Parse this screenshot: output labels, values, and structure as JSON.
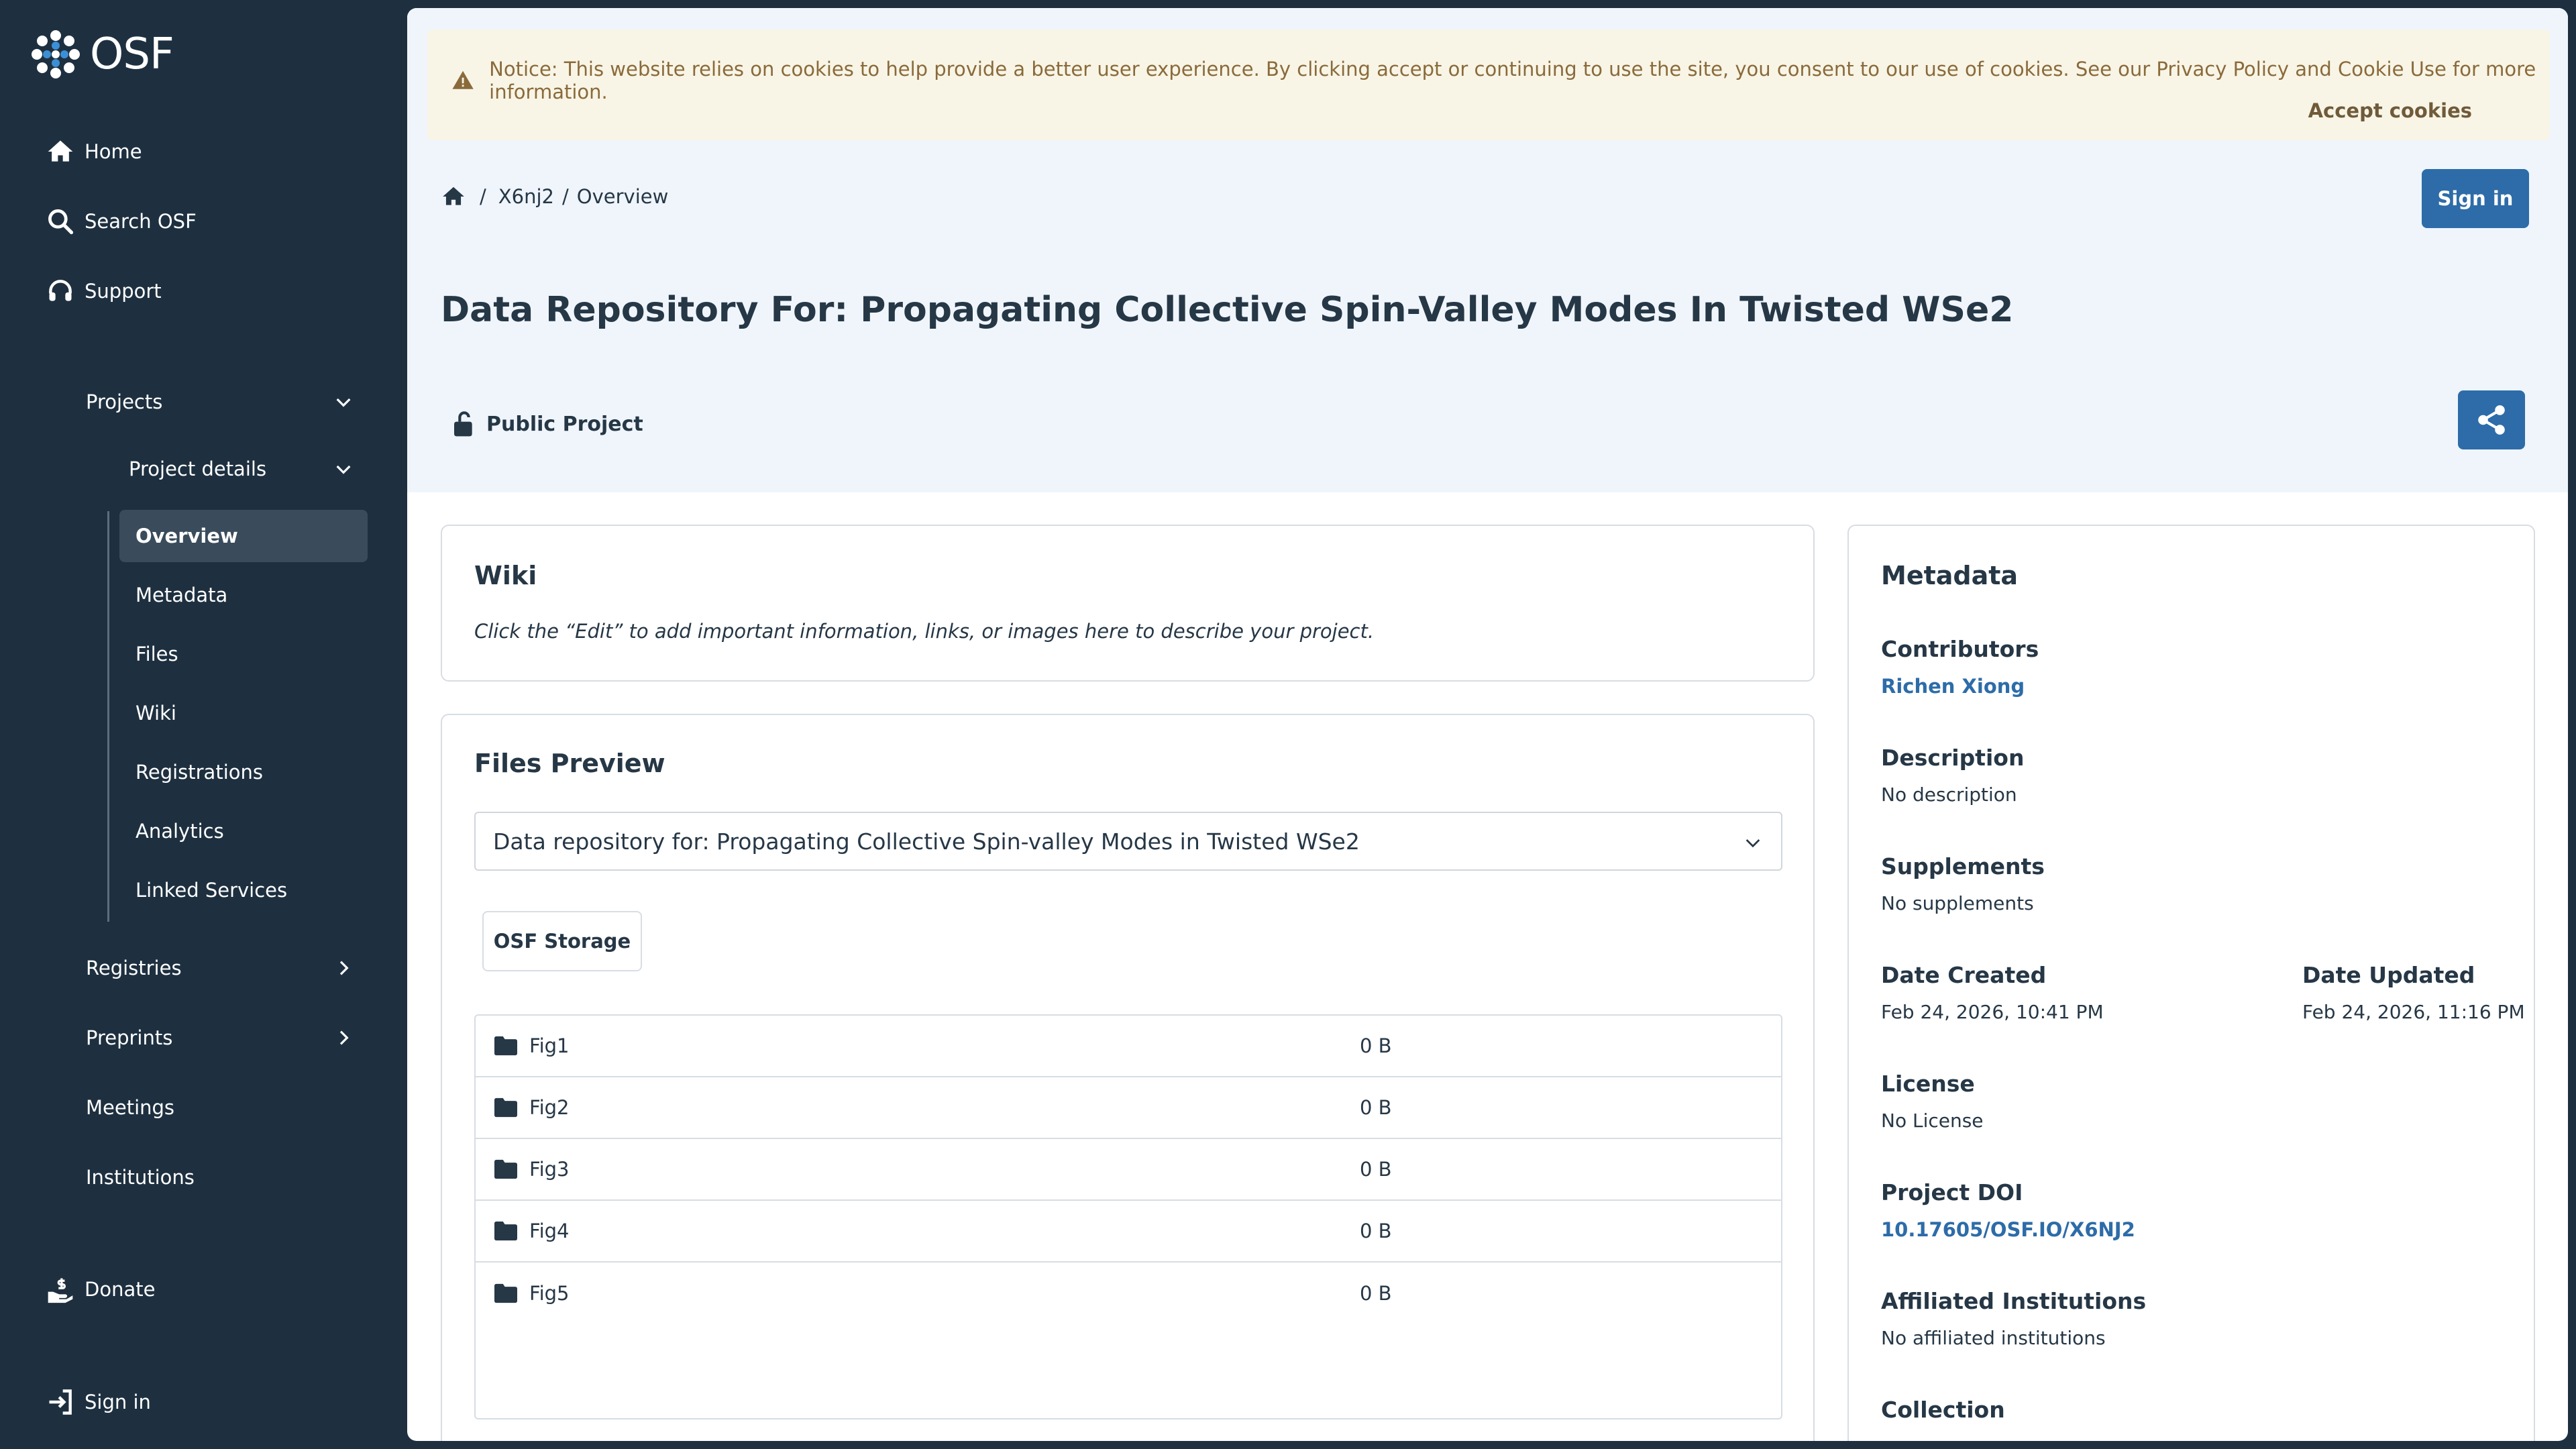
{
  "app": {
    "logo_text": "OSF"
  },
  "sidebar": {
    "home": "Home",
    "search": "Search OSF",
    "support": "Support",
    "projects": "Projects",
    "project_details": "Project details",
    "tree": [
      "Overview",
      "Metadata",
      "Files",
      "Wiki",
      "Registrations",
      "Analytics",
      "Linked Services"
    ],
    "active_item": "Overview",
    "registries": "Registries",
    "preprints": "Preprints",
    "meetings": "Meetings",
    "institutions": "Institutions",
    "donate": "Donate",
    "sign_in": "Sign in"
  },
  "cookie": {
    "message": "Notice: This website relies on cookies to help provide a better user experience. By clicking accept or continuing to use the site, you consent to our use of cookies. See our Privacy Policy and Cookie Use for more information.",
    "accept_label": "Accept cookies"
  },
  "header": {
    "breadcrumb_sep": "/",
    "breadcrumb_project": "X6nj2",
    "breadcrumb_page": "Overview",
    "sign_in_label": "Sign in",
    "title": "Data Repository For: Propagating Collective Spin-Valley Modes In Twisted WSe2",
    "visibility": "Public Project"
  },
  "wiki": {
    "title": "Wiki",
    "text": "Click the “Edit” to add important information, links, or images here to describe your project."
  },
  "files_preview": {
    "title": "Files Preview",
    "selected_project": "Data repository for: Propagating Collective Spin-valley Modes in Twisted WSe2",
    "storage_tab": "OSF Storage",
    "files": [
      {
        "name": "Fig1",
        "size": "0 B"
      },
      {
        "name": "Fig2",
        "size": "0 B"
      },
      {
        "name": "Fig3",
        "size": "0 B"
      },
      {
        "name": "Fig4",
        "size": "0 B"
      },
      {
        "name": "Fig5",
        "size": "0 B"
      }
    ]
  },
  "metadata": {
    "title": "Metadata",
    "contributors_label": "Contributors",
    "contributor": "Richen Xiong",
    "description_label": "Description",
    "description": "No description",
    "supplements_label": "Supplements",
    "supplements": "No supplements",
    "date_created_label": "Date Created",
    "date_created": "Feb 24, 2026, 10:41 PM",
    "date_updated_label": "Date Updated",
    "date_updated": "Feb 24, 2026, 11:16 PM",
    "license_label": "License",
    "license": "No License",
    "doi_label": "Project DOI",
    "doi": "10.17605/OSF.IO/X6NJ2",
    "affiliated_label": "Affiliated Institutions",
    "affiliated": "No affiliated institutions",
    "collection_label": "Collection"
  },
  "colors": {
    "sidebar_bg": "#1e3040",
    "primary_button": "#2d6ca8",
    "hero_bg": "#eff5fb",
    "cookie_bg": "#f8f5e6"
  }
}
